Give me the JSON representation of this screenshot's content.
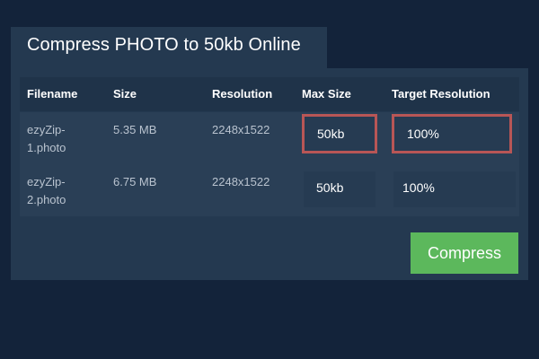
{
  "header": {
    "title": "Compress PHOTO to 50kb Online"
  },
  "table": {
    "columns": [
      "Filename",
      "Size",
      "Resolution",
      "Max Size",
      "Target Resolution"
    ],
    "rows": [
      {
        "filename": "ezyZip-1.photo",
        "size": "5.35 MB",
        "resolution": "2248x1522",
        "max_size": "50kb",
        "target_resolution": "100%"
      },
      {
        "filename": "ezyZip-2.photo",
        "size": "6.75 MB",
        "resolution": "2248x1522",
        "max_size": "50kb",
        "target_resolution": "100%"
      }
    ]
  },
  "actions": {
    "compress_label": "Compress"
  },
  "colors": {
    "background": "#13233a",
    "panel": "#243950",
    "highlight_border": "#b85656",
    "compress_button": "#5cb85c"
  }
}
